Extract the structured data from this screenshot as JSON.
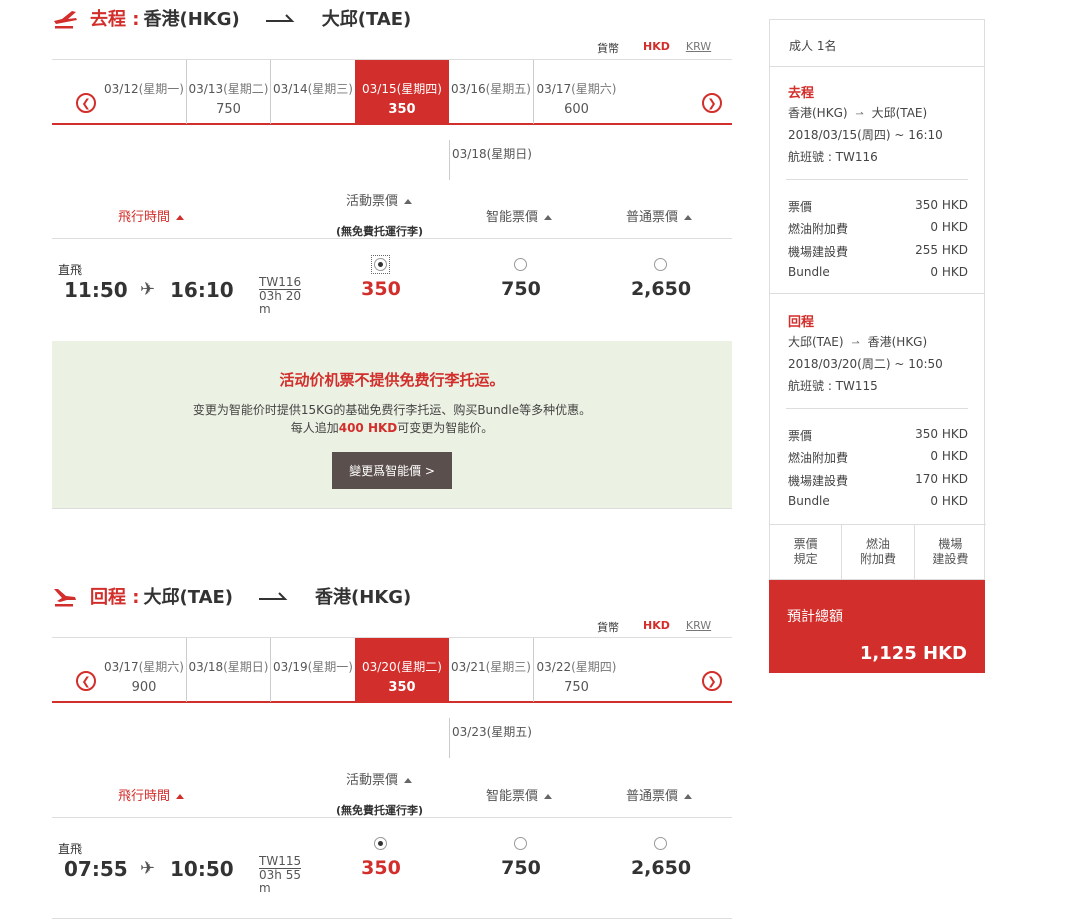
{
  "currency": {
    "label": "貨幣",
    "options": [
      "HKD",
      "KRW"
    ],
    "selected": "HKD"
  },
  "outbound": {
    "label": "去程 :",
    "from": "香港(HKG)",
    "to": "大邱(TAE)",
    "dates": [
      {
        "date": "03/12",
        "weekday": "(星期一)",
        "price": ""
      },
      {
        "date": "03/13",
        "weekday": "(星期二)",
        "price": "750"
      },
      {
        "date": "03/14",
        "weekday": "(星期三)",
        "price": ""
      },
      {
        "date": "03/15",
        "weekday": "(星期四)",
        "price": "350",
        "active": true
      },
      {
        "date": "03/16",
        "weekday": "(星期五)",
        "price": ""
      },
      {
        "date": "03/17",
        "weekday": "(星期六)",
        "price": "600"
      }
    ],
    "extra_date": {
      "date": "03/18",
      "weekday": "(星期日)"
    },
    "columns": {
      "flight_time": "飛行時間",
      "promo": "活動票價",
      "promo_note": "(無免費托運行李)",
      "smart": "智能票價",
      "normal": "普通票價"
    },
    "flight": {
      "type": "直飛",
      "depart": "11:50",
      "arrive": "16:10",
      "flight_no": "TW116",
      "duration": "03h 20 m",
      "promo_price": "350",
      "smart_price": "750",
      "normal_price": "2,650",
      "selected": "promo"
    },
    "notice": {
      "headline": "活动价机票不提供免费行李托运。",
      "line1": "变更为智能价时提供15KG的基础免费行李托运、购买Bundle等多种优惠。",
      "line2_pre": "每人追加",
      "line2_amount": "400 HKD",
      "line2_post": "可变更为智能价。",
      "button": "變更爲智能價 >"
    }
  },
  "inbound": {
    "label": "回程 :",
    "from": "大邱(TAE)",
    "to": "香港(HKG)",
    "dates": [
      {
        "date": "03/17",
        "weekday": "(星期六)",
        "price": "900"
      },
      {
        "date": "03/18",
        "weekday": "(星期日)",
        "price": ""
      },
      {
        "date": "03/19",
        "weekday": "(星期一)",
        "price": ""
      },
      {
        "date": "03/20",
        "weekday": "(星期二)",
        "price": "350",
        "active": true
      },
      {
        "date": "03/21",
        "weekday": "(星期三)",
        "price": ""
      },
      {
        "date": "03/22",
        "weekday": "(星期四)",
        "price": "750"
      }
    ],
    "extra_date": {
      "date": "03/23",
      "weekday": "(星期五)"
    },
    "flight": {
      "type": "直飛",
      "depart": "07:55",
      "arrive": "10:50",
      "flight_no": "TW115",
      "duration": "03h 55 m",
      "promo_price": "350",
      "smart_price": "750",
      "normal_price": "2,650",
      "selected": "promo"
    }
  },
  "summary": {
    "passengers": "成人 1名",
    "outbound": {
      "title": "去程",
      "route_from": "香港(HKG)",
      "route_to": "大邱(TAE)",
      "datetime": "2018/03/15(周四) ~ 16:10",
      "flight": "航班號 : TW116",
      "fees": [
        {
          "label": "票價",
          "value": "350 HKD"
        },
        {
          "label": "燃油附加費",
          "value": "0 HKD"
        },
        {
          "label": "機場建設費",
          "value": "255 HKD"
        },
        {
          "label": "Bundle",
          "value": "0 HKD"
        }
      ]
    },
    "inbound": {
      "title": "回程",
      "route_from": "大邱(TAE)",
      "route_to": "香港(HKG)",
      "datetime": "2018/03/20(周二) ~ 10:50",
      "flight": "航班號 : TW115",
      "fees": [
        {
          "label": "票價",
          "value": "350 HKD"
        },
        {
          "label": "燃油附加費",
          "value": "0 HKD"
        },
        {
          "label": "機場建設費",
          "value": "170 HKD"
        },
        {
          "label": "Bundle",
          "value": "0 HKD"
        }
      ]
    },
    "tabs": [
      {
        "l1": "票價",
        "l2": "規定"
      },
      {
        "l1": "燃油",
        "l2": "附加費"
      },
      {
        "l1": "機場",
        "l2": "建設費"
      }
    ],
    "total_label": "預計總額",
    "total_value": "1,125 HKD"
  },
  "colors": {
    "accent": "#d22e2b",
    "notice_bg": "#ebf1e3",
    "button_bg": "#5a4f4c"
  },
  "icons": [
    "takeoff-icon",
    "landing-icon",
    "route-arrow-icon",
    "chevron-left-icon",
    "chevron-right-icon",
    "plane-icon",
    "sort-up-icon",
    "radio-icon"
  ]
}
